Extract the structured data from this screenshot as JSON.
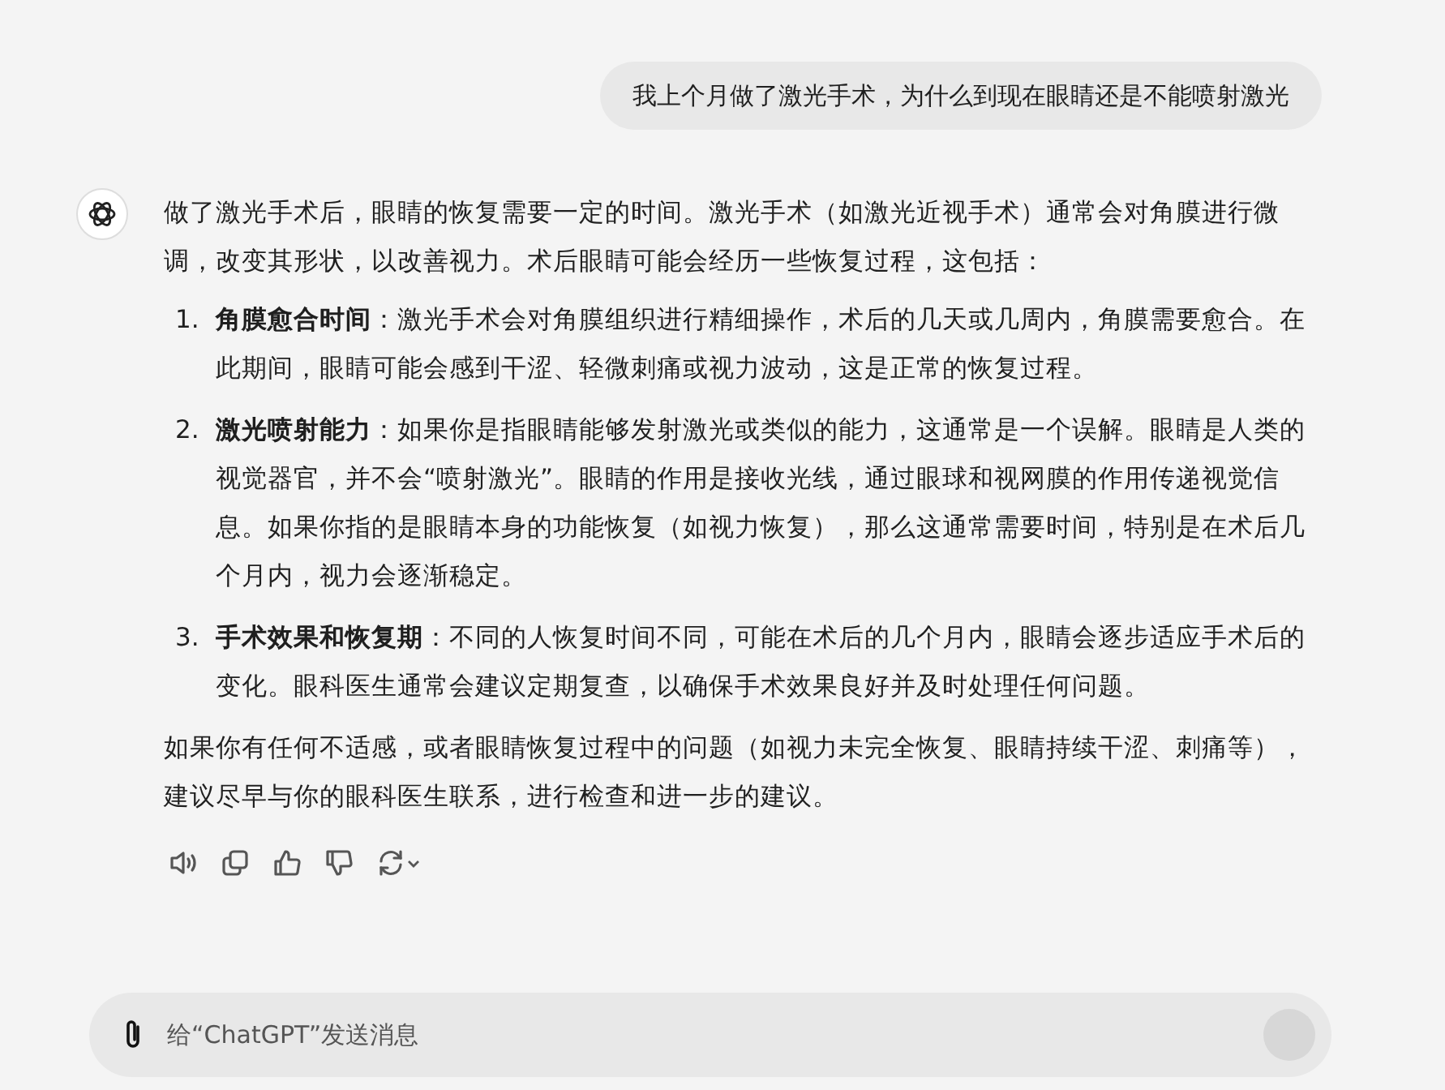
{
  "user_message": "我上个月做了激光手术，为什么到现在眼睛还是不能喷射激光",
  "reply": {
    "intro": "做了激光手术后，眼睛的恢复需要一定的时间。激光手术（如激光近视手术）通常会对角膜进行微调，改变其形状，以改善视力。术后眼睛可能会经历一些恢复过程，这包括：",
    "items": [
      {
        "number": "1.",
        "text": "**角膜愈合时间**：激光手术会对角膜组织进行精细操作，术后的几天或几周内，角膜需要愈合。在此期间，眼睛可能会感到干涩、轻微刺痛或视力波动，这是正常的恢复过程。"
      },
      {
        "number": "2.",
        "text": "**激光喷射能力**：如果你是指眼睛能够发射激光或类似的能力，这通常是一个误解。眼睛是人类的视觉器官，并不会“喷射激光”。眼睛的作用是接收光线，通过眼球和视网膜的作用传递视觉信息。如果你指的是眼睛本身的功能恢复（如视力恢复），那么这通常需要时间，特别是在术后几个月内，视力会逐渐稳定。"
      },
      {
        "number": "3.",
        "text": "**手术效果和恢复期**：不同的人恢复时间不同，可能在术后的几个月内，眼睛会逐步适应手术后的变化。眼科医生通常会建议定期复查，以确保手术效果良好并及时处理任何问题。"
      }
    ],
    "outro": "如果你有任何不适感，或者眼睛恢复过程中的问题（如视力未完全恢复、眼睛持续干涩、刺痛等），建议尽早与你的眼科医生联系，进行检查和进一步的建议。"
  },
  "actions": [
    {
      "kind": "speaker"
    },
    {
      "kind": "copy"
    },
    {
      "kind": "thumbs_up"
    },
    {
      "kind": "thumbs_down"
    },
    {
      "kind": "regenerate"
    }
  ],
  "composer": {
    "placeholder": "给“ChatGPT”发送消息"
  }
}
